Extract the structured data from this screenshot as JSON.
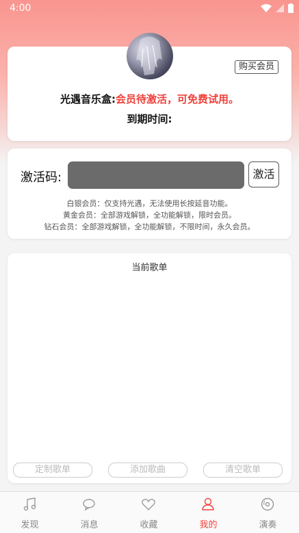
{
  "status_bar": {
    "time": "4:00"
  },
  "profile": {
    "buy_button": "购买会员",
    "member_label": "光遇音乐盒:",
    "member_status": "会员待激活，可免费试用。",
    "expire_label": "到期时间:"
  },
  "activation": {
    "code_label": "激活码:",
    "code_value": "",
    "activate_button": "激活",
    "descriptions": [
      "白银会员：仅支持光遇，无法使用长按延音功能。",
      "黄金会员：全部游戏解锁，全功能解锁，限时会员。",
      "钻石会员：全部游戏解锁，全功能解锁，不限时间，永久会员。"
    ]
  },
  "playlist": {
    "title": "当前歌单",
    "buttons": [
      "定制歌单",
      "添加歌曲",
      "清空歌单"
    ]
  },
  "bottom_nav": {
    "items": [
      {
        "label": "发现",
        "icon": "music-note-icon"
      },
      {
        "label": "消息",
        "icon": "chat-bubble-icon"
      },
      {
        "label": "收藏",
        "icon": "heart-icon"
      },
      {
        "label": "我的",
        "icon": "person-icon"
      },
      {
        "label": "演奏",
        "icon": "vinyl-record-icon"
      }
    ],
    "active_index": 3
  },
  "colors": {
    "accent": "#f0403a",
    "header_gradient_top": "#f9958f",
    "input_bg": "#6b6b6b"
  }
}
